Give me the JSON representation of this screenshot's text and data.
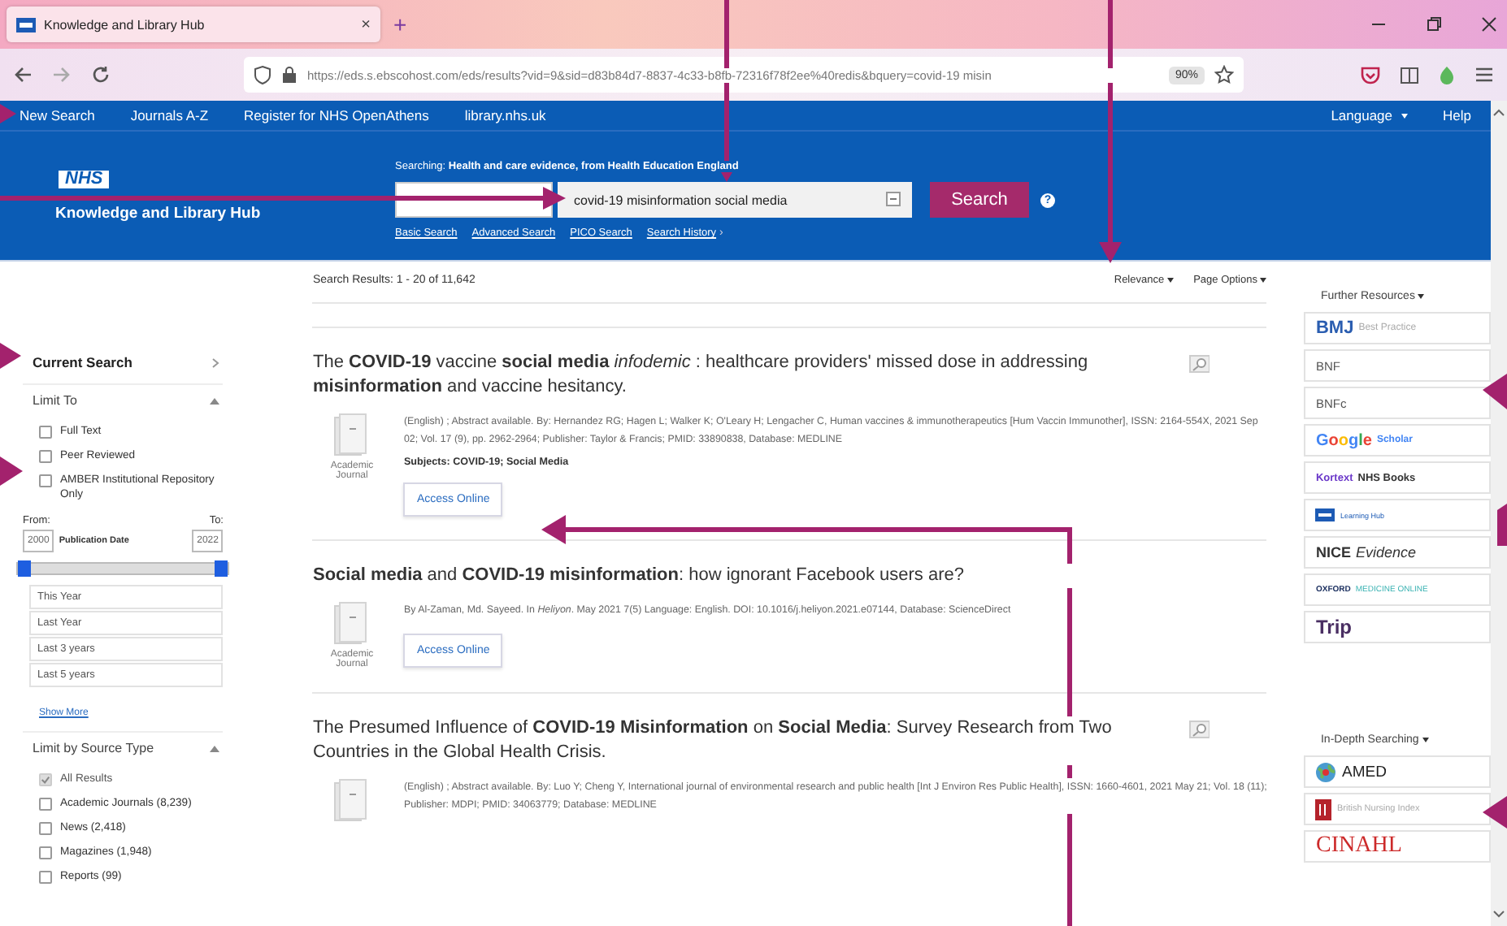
{
  "browser": {
    "tab": {
      "title": "Knowledge and Library Hub",
      "close": "×"
    },
    "new_tab": "+",
    "address": "https://eds.s.ebscohost.com/eds/results?vid=9&sid=d83b84d7-8837-4c33-b8fb-72316f78f2ee%40redis&bquery=covid-19 misin",
    "zoom": "90%"
  },
  "top_nav": {
    "links": [
      "New Search",
      "Journals A-Z",
      "Register for NHS OpenAthens",
      "library.nhs.uk"
    ],
    "right": [
      {
        "label": "Language",
        "dropdown": true
      },
      {
        "label": "Help",
        "dropdown": false
      }
    ]
  },
  "header": {
    "logo": "NHS",
    "title": "Knowledge and Library Hub",
    "searching": "Searching: **Health and care evidence, from Health Education England**",
    "query": {
      "value": "covid-19 misinformation social media"
    },
    "search_button": "Search",
    "help": "?",
    "links": [
      "Basic Search",
      "Advanced Search",
      "PICO Search",
      "Search History"
    ],
    "history_chevron": "›"
  },
  "sidebar": {
    "current_search": "Current Search",
    "limit_to": {
      "label": "Limit To",
      "expanded": true,
      "options": [
        {
          "label": "Full Text",
          "checked": false
        },
        {
          "label": "Peer Reviewed",
          "checked": false
        },
        {
          "label": "AMBER Institutional Repository Only",
          "checked": false
        }
      ]
    },
    "date": {
      "from_label": "From:",
      "to_label": "To:",
      "from": "2000",
      "to": "2022",
      "label": "Publication Date",
      "thumbs": [
        {
          "level": 0
        },
        {
          "level": 1
        }
      ]
    },
    "presets": [
      "This Year",
      "Last Year",
      "Last 3 years",
      "Last 5 years"
    ],
    "show_more": "Show More",
    "source_type": {
      "label": "Limit by Source Type",
      "expanded": true,
      "options": [
        {
          "label": "All Results",
          "checked": true,
          "disabled": true
        },
        {
          "label": "Academic Journals (8,239)",
          "checked": false,
          "disabled": false
        },
        {
          "label": "News (2,418)",
          "checked": false,
          "disabled": false
        },
        {
          "label": "Magazines (1,948)",
          "checked": false,
          "disabled": false
        },
        {
          "label": "Reports (99)",
          "checked": false,
          "disabled": false
        }
      ]
    }
  },
  "results_bar": {
    "count": "Search Results: 1 - 20 of 11,642",
    "sort": "Relevance",
    "page_options": "Page Options"
  },
  "results": [
    {
      "title": "The **COVID-19** vaccine **social** **media** *infodemic* : healthcare providers' missed dose in addressing **misinformation** and vaccine hesitancy.",
      "preview": true,
      "meta": "(English) ; Abstract available. By: Hernandez RG; Hagen L; Walker K; O'Leary H; Lengacher C, Human vaccines & immunotherapeutics [Hum Vaccin Immunother], ISSN: 2164-554X, 2021 Sep 02; Vol. 17 (9), pp. 2962-2964; Publisher: Taylor & Francis; PMID: 33890838, Database: MEDLINE",
      "subjects": "Subjects: COVID-19; Social Media",
      "type": "Academic Journal",
      "button": "Access Online"
    },
    {
      "title": "**Social** **media** and **COVID-19** **misinformation**: how ignorant Facebook users are?",
      "preview": false,
      "meta": "By Al-Zaman, Md. Sayeed. In *Heliyon*. May 2021 7(5) Language: English. DOI: 10.1016/j.heliyon.2021.e07144, Database: ScienceDirect",
      "type": "Academic Journal",
      "button": "Access Online"
    },
    {
      "title": "The Presumed Influence of **COVID-19** **Misinformation** on **Social** **Media**: Survey Research from Two Countries in the Global Health Crisis.",
      "preview": true,
      "meta": "(English) ; Abstract available. By: Luo Y; Cheng Y, International journal of environmental research and public health [Int J Environ Res Public Health], ISSN: 1660-4601, 2021 May 21; Vol. 18 (11); Publisher: MDPI; PMID: 34063779; Database: MEDLINE"
    }
  ],
  "resources": {
    "further_label": "Further Resources",
    "further": [
      {
        "kind": "bmj",
        "text": "BMJ",
        "sub": "Best Practice"
      },
      {
        "kind": "plain",
        "text": "BNF"
      },
      {
        "kind": "plain",
        "text": "BNFc"
      },
      {
        "kind": "google",
        "text": "Google",
        "sub": "Scholar"
      },
      {
        "kind": "kortext",
        "text": "Kortext",
        "sub": "NHS Books"
      },
      {
        "kind": "learninghub",
        "text": "Learning Hub"
      },
      {
        "kind": "nice",
        "text": "NICE",
        "sub": "Evidence"
      },
      {
        "kind": "oxford",
        "text": "OXFORD",
        "sub": "MEDICINE ONLINE"
      },
      {
        "kind": "trip",
        "text": "Trip"
      }
    ],
    "indepth_label": "In-Depth Searching",
    "indepth": [
      {
        "kind": "amed",
        "text": "AMED"
      },
      {
        "kind": "bni",
        "text": "British Nursing Index"
      },
      {
        "kind": "cinahl",
        "text": "CINAHL"
      }
    ]
  }
}
